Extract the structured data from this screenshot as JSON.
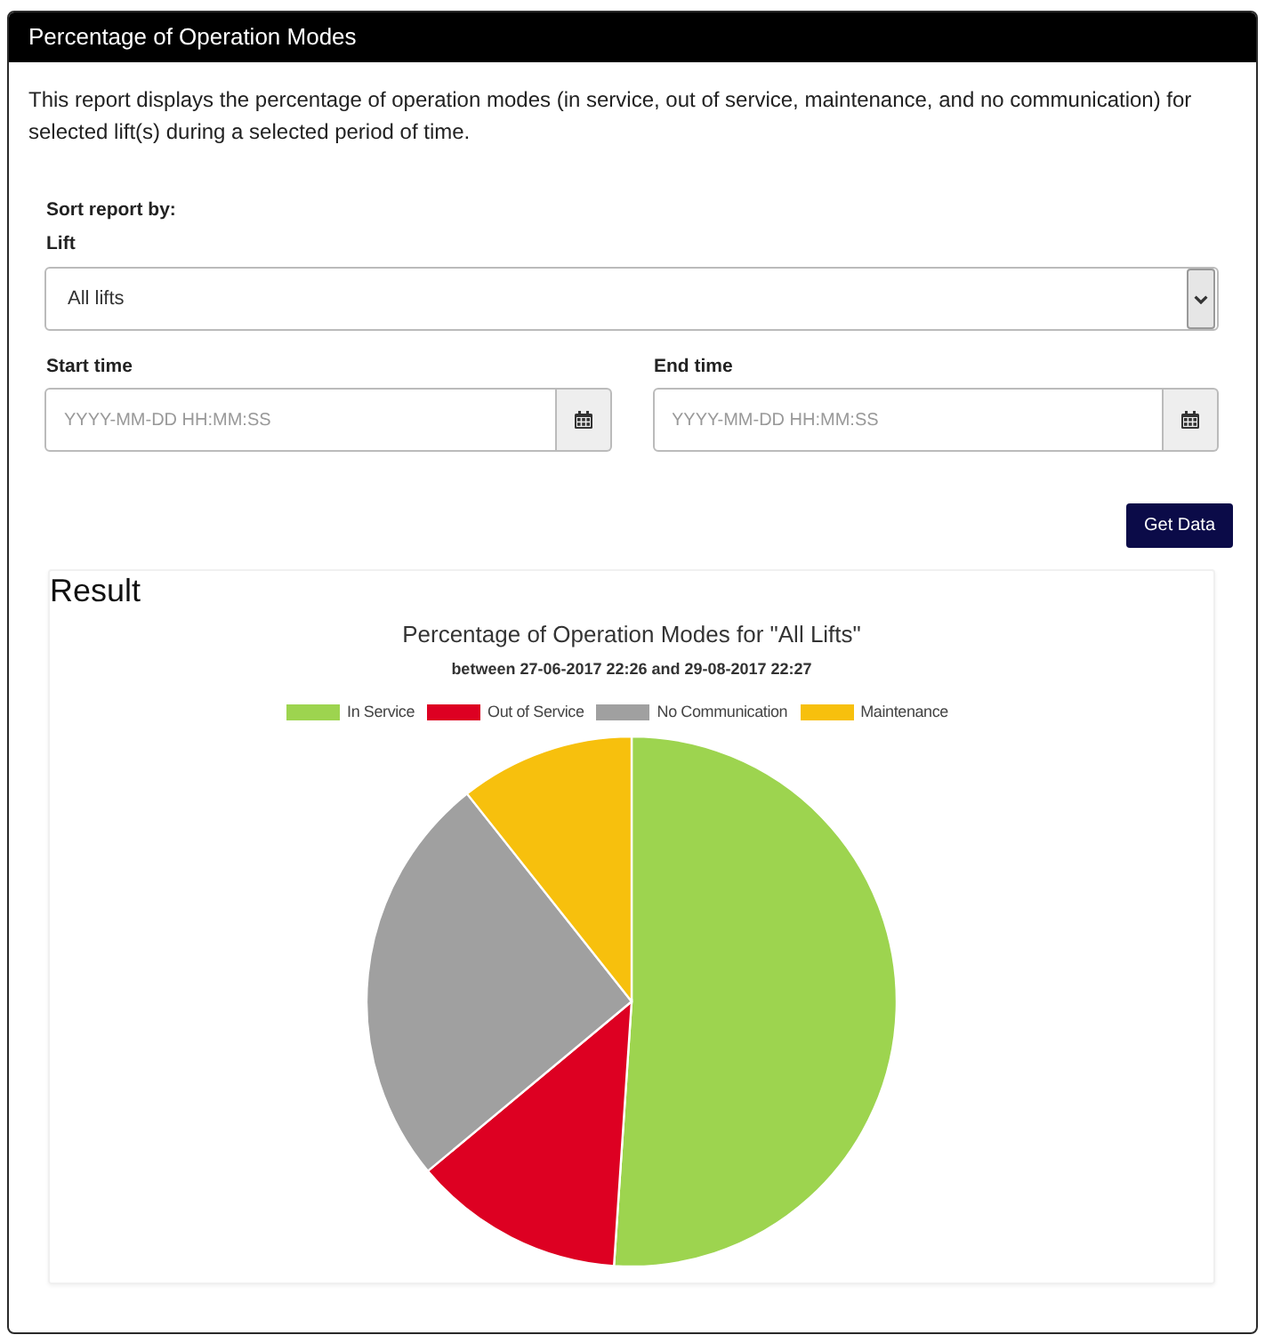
{
  "panel": {
    "title": "Percentage of Operation Modes",
    "description": "This report displays the percentage of operation modes (in service, out of service, maintenance, and no communication) for selected lift(s) during a selected period of time."
  },
  "form": {
    "heading": "Sort report by:",
    "lift": {
      "label": "Lift",
      "value": "All lifts"
    },
    "start_time": {
      "label": "Start time",
      "placeholder": "YYYY-MM-DD HH:MM:SS"
    },
    "end_time": {
      "label": "End time",
      "placeholder": "YYYY-MM-DD HH:MM:SS"
    },
    "submit": "Get Data"
  },
  "result": {
    "heading": "Result",
    "chart": {
      "title": "Percentage of Operation Modes for \"All Lifts\"",
      "subtitle": "between 27-06-2017 22:26 and 29-08-2017 22:27",
      "legend": [
        {
          "label": "In Service",
          "color": "#9dd44f"
        },
        {
          "label": "Out of Service",
          "color": "#dd0022"
        },
        {
          "label": "No Communication",
          "color": "#a0a0a0"
        },
        {
          "label": "Maintenance",
          "color": "#f7c00d"
        }
      ]
    }
  }
}
